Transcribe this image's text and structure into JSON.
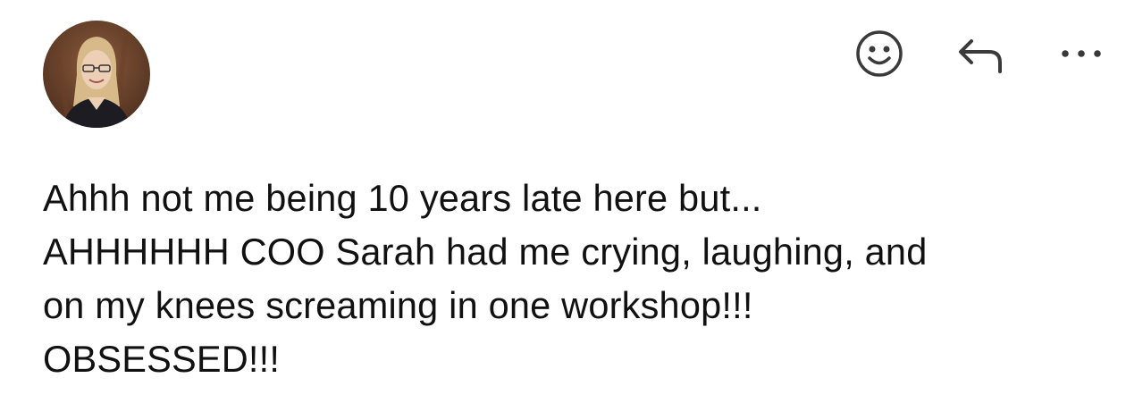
{
  "header": {
    "avatar_icon": "user-avatar-photo",
    "actions": [
      {
        "icon": "smiley-face-icon"
      },
      {
        "icon": "reply-arrow-icon"
      },
      {
        "icon": "more-options-icon"
      }
    ]
  },
  "message": {
    "lines": [
      "Ahhh not me being 10 years late here but...",
      "AHHHHHH COO Sarah had me crying, laughing, and",
      "on my knees screaming in one workshop!!!",
      "OBSESSED!!!"
    ]
  },
  "colors": {
    "icon": "#3a3a3a",
    "text": "#111111",
    "background": "#ffffff"
  }
}
